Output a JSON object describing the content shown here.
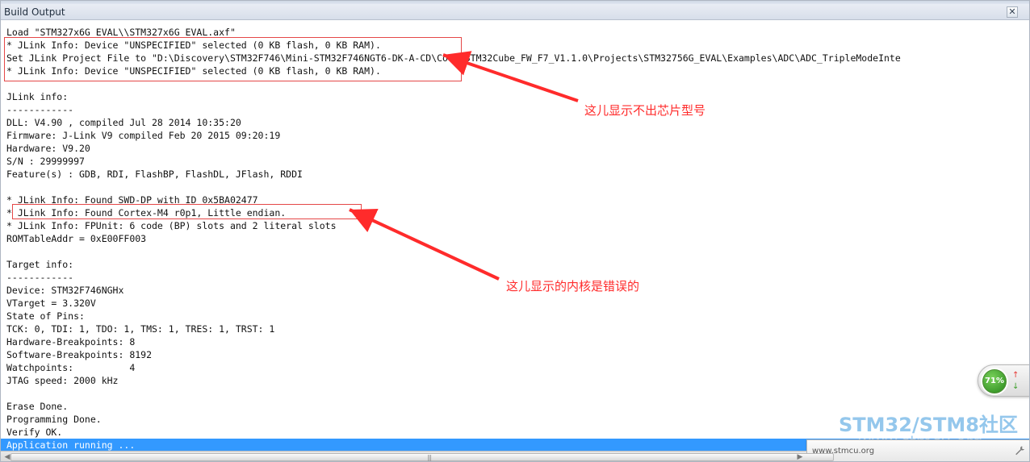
{
  "window": {
    "title": "Build Output",
    "close_icon_text": "✕"
  },
  "output": {
    "lines": [
      "Load \"STM327x6G_EVAL\\\\STM327x6G_EVAL.axf\"",
      "* JLink Info: Device \"UNSPECIFIED\" selected (0 KB flash, 0 KB RAM).",
      "Set JLink Project File to \"D:\\Discovery\\STM32F746\\Mini-STM32F746NGT6-DK-A-CD\\Code\\STM32Cube_FW_F7_V1.1.0\\Projects\\STM32756G_EVAL\\Examples\\ADC\\ADC_TripleModeInte",
      "* JLink Info: Device \"UNSPECIFIED\" selected (0 KB flash, 0 KB RAM).",
      "",
      "JLink info:",
      "------------",
      "DLL: V4.90 , compiled Jul 28 2014 10:35:20",
      "Firmware: J-Link V9 compiled Feb 20 2015 09:20:19",
      "Hardware: V9.20",
      "S/N : 29999997",
      "Feature(s) : GDB, RDI, FlashBP, FlashDL, JFlash, RDDI",
      "",
      "* JLink Info: Found SWD-DP with ID 0x5BA02477",
      "* JLink Info: Found Cortex-M4 r0p1, Little endian.",
      "* JLink Info: FPUnit: 6 code (BP) slots and 2 literal slots",
      "ROMTableAddr = 0xE00FF003",
      "",
      "Target info:",
      "------------",
      "Device: STM32F746NGHx",
      "VTarget = 3.320V",
      "State of Pins:",
      "TCK: 0, TDI: 1, TDO: 1, TMS: 1, TRES: 1, TRST: 1",
      "Hardware-Breakpoints: 8",
      "Software-Breakpoints: 8192",
      "Watchpoints:          4",
      "JTAG speed: 2000 kHz",
      "",
      "Erase Done.",
      "Programming Done.",
      "Verify OK.",
      "Application running ..."
    ]
  },
  "annotations": {
    "note1": "这儿显示不出芯片型号",
    "note2": "这儿显示的内核是错误的",
    "color": "#ff2b2b"
  },
  "widgets": {
    "progress_text": "71%",
    "up_icon": "↑",
    "down_icon": "↓",
    "watermark_main": "STM32/STM8社区",
    "watermark_sub": "www.stmcu.org",
    "bubble_text": "www.stmcu.org",
    "grip_text": "|||",
    "scroll_left": "◀",
    "scroll_right": "▶"
  }
}
